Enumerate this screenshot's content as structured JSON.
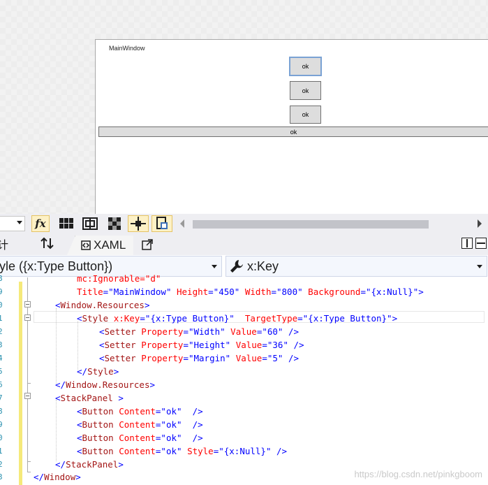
{
  "designer": {
    "window_title": "MainWindow",
    "buttons": [
      "ok",
      "ok",
      "ok",
      "ok"
    ]
  },
  "toolbar": {
    "zoom_value": "",
    "icons": [
      "fx-icon",
      "grid-icon",
      "snap-gridlines-icon",
      "checkerboard-icon",
      "snap-snaplines-icon",
      "device-icon"
    ]
  },
  "tabs": {
    "design_label": "计",
    "xaml_label": "XAML"
  },
  "navbar": {
    "left_selection": "yle ({x:Type Button})",
    "right_selection": "x:Key"
  },
  "editor": {
    "lines": [
      {
        "num": "8",
        "segments": [
          {
            "c": "a",
            "t": "mc:Ignorable=\"d\""
          }
        ]
      },
      {
        "num": "9",
        "segments": [
          {
            "c": "a",
            "t": "Title"
          },
          {
            "c": "p",
            "t": "=\"MainWindow\" "
          },
          {
            "c": "a",
            "t": "Height"
          },
          {
            "c": "p",
            "t": "=\"450\" "
          },
          {
            "c": "a",
            "t": "Width"
          },
          {
            "c": "p",
            "t": "=\"800\" "
          },
          {
            "c": "a",
            "t": "Background"
          },
          {
            "c": "p",
            "t": "=\"{x:Null}\">"
          }
        ]
      },
      {
        "num": "0",
        "segments": [
          {
            "c": "p",
            "t": "<"
          },
          {
            "c": "t",
            "t": "Window.Resources"
          },
          {
            "c": "p",
            "t": ">"
          }
        ]
      },
      {
        "num": "1",
        "segments": [
          {
            "c": "p",
            "t": "<"
          },
          {
            "c": "t",
            "t": "Style"
          },
          {
            "c": "p",
            "t": " "
          },
          {
            "c": "a",
            "t": "x:Key"
          },
          {
            "c": "p",
            "t": "=\"{x:Type Button}\"  "
          },
          {
            "c": "a",
            "t": "TargetType"
          },
          {
            "c": "p",
            "t": "=\"{x:Type Button}\">"
          }
        ]
      },
      {
        "num": "2",
        "segments": [
          {
            "c": "p",
            "t": "<"
          },
          {
            "c": "t",
            "t": "Setter"
          },
          {
            "c": "p",
            "t": " "
          },
          {
            "c": "a",
            "t": "Property"
          },
          {
            "c": "p",
            "t": "=\"Width\" "
          },
          {
            "c": "a",
            "t": "Value"
          },
          {
            "c": "p",
            "t": "=\"60\" />"
          }
        ]
      },
      {
        "num": "3",
        "segments": [
          {
            "c": "p",
            "t": "<"
          },
          {
            "c": "t",
            "t": "Setter"
          },
          {
            "c": "p",
            "t": " "
          },
          {
            "c": "a",
            "t": "Property"
          },
          {
            "c": "p",
            "t": "=\"Height\" "
          },
          {
            "c": "a",
            "t": "Value"
          },
          {
            "c": "p",
            "t": "=\"36\" />"
          }
        ]
      },
      {
        "num": "4",
        "segments": [
          {
            "c": "p",
            "t": "<"
          },
          {
            "c": "t",
            "t": "Setter"
          },
          {
            "c": "p",
            "t": " "
          },
          {
            "c": "a",
            "t": "Property"
          },
          {
            "c": "p",
            "t": "=\"Margin\" "
          },
          {
            "c": "a",
            "t": "Value"
          },
          {
            "c": "p",
            "t": "=\"5\" />"
          }
        ]
      },
      {
        "num": "5",
        "segments": [
          {
            "c": "p",
            "t": "</"
          },
          {
            "c": "t",
            "t": "Style"
          },
          {
            "c": "p",
            "t": ">"
          }
        ]
      },
      {
        "num": "6",
        "segments": [
          {
            "c": "p",
            "t": "</"
          },
          {
            "c": "t",
            "t": "Window.Resources"
          },
          {
            "c": "p",
            "t": ">"
          }
        ]
      },
      {
        "num": "7",
        "segments": [
          {
            "c": "p",
            "t": "<"
          },
          {
            "c": "t",
            "t": "StackPanel"
          },
          {
            "c": "p",
            "t": " >"
          }
        ]
      },
      {
        "num": "8",
        "segments": [
          {
            "c": "p",
            "t": "<"
          },
          {
            "c": "t",
            "t": "Button"
          },
          {
            "c": "p",
            "t": " "
          },
          {
            "c": "a",
            "t": "Content"
          },
          {
            "c": "p",
            "t": "=\"ok\"  />"
          }
        ]
      },
      {
        "num": "9",
        "segments": [
          {
            "c": "p",
            "t": "<"
          },
          {
            "c": "t",
            "t": "Button"
          },
          {
            "c": "p",
            "t": " "
          },
          {
            "c": "a",
            "t": "Content"
          },
          {
            "c": "p",
            "t": "=\"ok\"  />"
          }
        ]
      },
      {
        "num": "0",
        "segments": [
          {
            "c": "p",
            "t": "<"
          },
          {
            "c": "t",
            "t": "Button"
          },
          {
            "c": "p",
            "t": " "
          },
          {
            "c": "a",
            "t": "Content"
          },
          {
            "c": "p",
            "t": "=\"ok\"  />"
          }
        ]
      },
      {
        "num": "1",
        "segments": [
          {
            "c": "p",
            "t": "<"
          },
          {
            "c": "t",
            "t": "Button"
          },
          {
            "c": "p",
            "t": " "
          },
          {
            "c": "a",
            "t": "Content"
          },
          {
            "c": "p",
            "t": "=\"ok\" "
          },
          {
            "c": "a",
            "t": "Style"
          },
          {
            "c": "p",
            "t": "=\"{x:Null}\" />"
          }
        ]
      },
      {
        "num": "2",
        "segments": [
          {
            "c": "p",
            "t": "</"
          },
          {
            "c": "t",
            "t": "StackPanel"
          },
          {
            "c": "p",
            "t": ">"
          }
        ]
      },
      {
        "num": "3",
        "segments": [
          {
            "c": "p",
            "t": "</"
          },
          {
            "c": "t",
            "t": "Window"
          },
          {
            "c": "p",
            "t": ">"
          }
        ]
      }
    ]
  },
  "watermark": "https://blog.csdn.net/pinkgboom"
}
